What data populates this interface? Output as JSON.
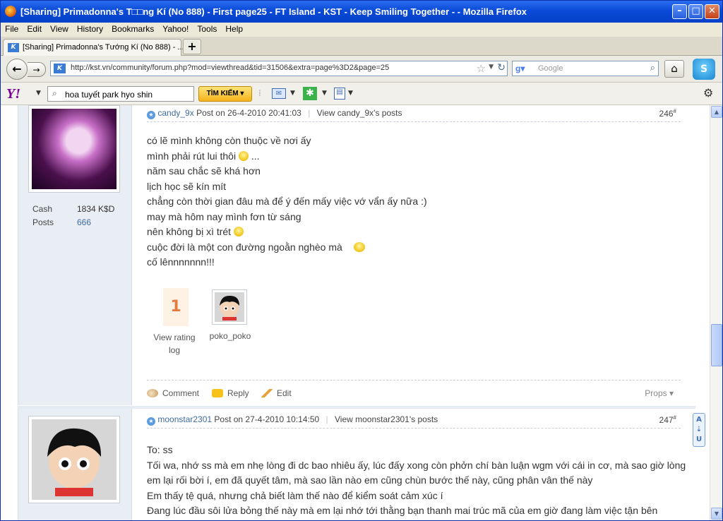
{
  "window": {
    "title": "[Sharing] Primadonna's T□□ng Kí (No 888) - First page25 - FT Island - KST - Keep Smiling Together - - Mozilla Firefox",
    "minimize": "–",
    "maximize": "□",
    "close": "✕"
  },
  "menu": [
    "File",
    "Edit",
    "View",
    "History",
    "Bookmarks",
    "Yahoo!",
    "Tools",
    "Help"
  ],
  "tab": {
    "label": "[Sharing] Primadonna's Tướng Kí (No 888) - ...",
    "newtab": "+"
  },
  "nav": {
    "url": "http://kst.vn/community/forum.php?mod=viewthread&tid=31506&extra=page%3D2&page=25",
    "search_placeholder": "Google",
    "back": "←",
    "forward": "→"
  },
  "yahoo": {
    "logo": "Y!",
    "search_value": "hoa tuyết park hyo shin",
    "search_button": "TÌM KIẾM ▾"
  },
  "posts": [
    {
      "author": "candy_9x",
      "posted": "Post on 26-4-2010 20:41:03",
      "view": "View candy_9x's posts",
      "number": "246",
      "cash_label": "Cash",
      "cash_value": "1834 K$D",
      "posts_label": "Posts",
      "posts_value": "666",
      "lines": [
        "có lẽ mình không còn thuộc về nơi ấy",
        "mình phải rút lui thôi",
        "...",
        "năm sau chắc sẽ khá hơn",
        "lịch học sẽ kín mít",
        "chẳng còn thời gian đâu mà để ý đến mấy việc vớ vẩn ấy nữa :)",
        "may mà hôm nay mình fơn từ sáng",
        "nên không bị xì trét",
        "cuộc đời là một con đường ngoằn nghèo mà",
        "cố lênnnnnnn!!!"
      ],
      "rating_value": "1",
      "rating_label": "View rating log",
      "rater_name": "poko_poko",
      "actions": {
        "comment": "Comment",
        "reply": "Reply",
        "edit": "Edit",
        "props": "Props ▾"
      }
    },
    {
      "author": "moonstar2301",
      "posted": "Post on 27-4-2010 10:14:50",
      "view": "View moonstar2301's posts",
      "number": "247",
      "lines": [
        "To: ss",
        "Tối wa, nhớ ss mà em nhẹ lòng đi dc bao nhiêu ấy, lúc đấy xong còn phởn chí bàn luận wgm với cái in cơ, mà sao giờ lòng",
        "em lại rối bời í, em đã quyết tâm, mà sao lần nào em cũng chùn bước thế này, cũng phân vân thế này",
        "Em thấy tệ quá, nhưng chả biết làm thế nào để kiểm soát cảm xúc í",
        "Đang lúc đầu sôi lửa bỏng thế này mà em lại nhớ tới thằng bạn thanh mai trúc mã của em giờ đang làm việc tận bên"
      ]
    }
  ],
  "side_tool": "A\nU"
}
